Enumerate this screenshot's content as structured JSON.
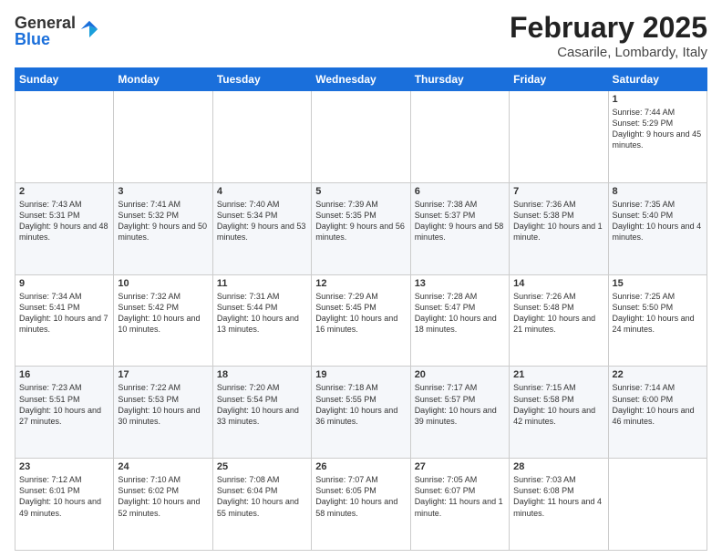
{
  "logo": {
    "general": "General",
    "blue": "Blue"
  },
  "title": "February 2025",
  "subtitle": "Casarile, Lombardy, Italy",
  "days": [
    "Sunday",
    "Monday",
    "Tuesday",
    "Wednesday",
    "Thursday",
    "Friday",
    "Saturday"
  ],
  "weeks": [
    [
      {
        "day": "",
        "content": ""
      },
      {
        "day": "",
        "content": ""
      },
      {
        "day": "",
        "content": ""
      },
      {
        "day": "",
        "content": ""
      },
      {
        "day": "",
        "content": ""
      },
      {
        "day": "",
        "content": ""
      },
      {
        "day": "1",
        "content": "Sunrise: 7:44 AM\nSunset: 5:29 PM\nDaylight: 9 hours and 45 minutes."
      }
    ],
    [
      {
        "day": "2",
        "content": "Sunrise: 7:43 AM\nSunset: 5:31 PM\nDaylight: 9 hours and 48 minutes."
      },
      {
        "day": "3",
        "content": "Sunrise: 7:41 AM\nSunset: 5:32 PM\nDaylight: 9 hours and 50 minutes."
      },
      {
        "day": "4",
        "content": "Sunrise: 7:40 AM\nSunset: 5:34 PM\nDaylight: 9 hours and 53 minutes."
      },
      {
        "day": "5",
        "content": "Sunrise: 7:39 AM\nSunset: 5:35 PM\nDaylight: 9 hours and 56 minutes."
      },
      {
        "day": "6",
        "content": "Sunrise: 7:38 AM\nSunset: 5:37 PM\nDaylight: 9 hours and 58 minutes."
      },
      {
        "day": "7",
        "content": "Sunrise: 7:36 AM\nSunset: 5:38 PM\nDaylight: 10 hours and 1 minute."
      },
      {
        "day": "8",
        "content": "Sunrise: 7:35 AM\nSunset: 5:40 PM\nDaylight: 10 hours and 4 minutes."
      }
    ],
    [
      {
        "day": "9",
        "content": "Sunrise: 7:34 AM\nSunset: 5:41 PM\nDaylight: 10 hours and 7 minutes."
      },
      {
        "day": "10",
        "content": "Sunrise: 7:32 AM\nSunset: 5:42 PM\nDaylight: 10 hours and 10 minutes."
      },
      {
        "day": "11",
        "content": "Sunrise: 7:31 AM\nSunset: 5:44 PM\nDaylight: 10 hours and 13 minutes."
      },
      {
        "day": "12",
        "content": "Sunrise: 7:29 AM\nSunset: 5:45 PM\nDaylight: 10 hours and 16 minutes."
      },
      {
        "day": "13",
        "content": "Sunrise: 7:28 AM\nSunset: 5:47 PM\nDaylight: 10 hours and 18 minutes."
      },
      {
        "day": "14",
        "content": "Sunrise: 7:26 AM\nSunset: 5:48 PM\nDaylight: 10 hours and 21 minutes."
      },
      {
        "day": "15",
        "content": "Sunrise: 7:25 AM\nSunset: 5:50 PM\nDaylight: 10 hours and 24 minutes."
      }
    ],
    [
      {
        "day": "16",
        "content": "Sunrise: 7:23 AM\nSunset: 5:51 PM\nDaylight: 10 hours and 27 minutes."
      },
      {
        "day": "17",
        "content": "Sunrise: 7:22 AM\nSunset: 5:53 PM\nDaylight: 10 hours and 30 minutes."
      },
      {
        "day": "18",
        "content": "Sunrise: 7:20 AM\nSunset: 5:54 PM\nDaylight: 10 hours and 33 minutes."
      },
      {
        "day": "19",
        "content": "Sunrise: 7:18 AM\nSunset: 5:55 PM\nDaylight: 10 hours and 36 minutes."
      },
      {
        "day": "20",
        "content": "Sunrise: 7:17 AM\nSunset: 5:57 PM\nDaylight: 10 hours and 39 minutes."
      },
      {
        "day": "21",
        "content": "Sunrise: 7:15 AM\nSunset: 5:58 PM\nDaylight: 10 hours and 42 minutes."
      },
      {
        "day": "22",
        "content": "Sunrise: 7:14 AM\nSunset: 6:00 PM\nDaylight: 10 hours and 46 minutes."
      }
    ],
    [
      {
        "day": "23",
        "content": "Sunrise: 7:12 AM\nSunset: 6:01 PM\nDaylight: 10 hours and 49 minutes."
      },
      {
        "day": "24",
        "content": "Sunrise: 7:10 AM\nSunset: 6:02 PM\nDaylight: 10 hours and 52 minutes."
      },
      {
        "day": "25",
        "content": "Sunrise: 7:08 AM\nSunset: 6:04 PM\nDaylight: 10 hours and 55 minutes."
      },
      {
        "day": "26",
        "content": "Sunrise: 7:07 AM\nSunset: 6:05 PM\nDaylight: 10 hours and 58 minutes."
      },
      {
        "day": "27",
        "content": "Sunrise: 7:05 AM\nSunset: 6:07 PM\nDaylight: 11 hours and 1 minute."
      },
      {
        "day": "28",
        "content": "Sunrise: 7:03 AM\nSunset: 6:08 PM\nDaylight: 11 hours and 4 minutes."
      },
      {
        "day": "",
        "content": ""
      }
    ]
  ]
}
